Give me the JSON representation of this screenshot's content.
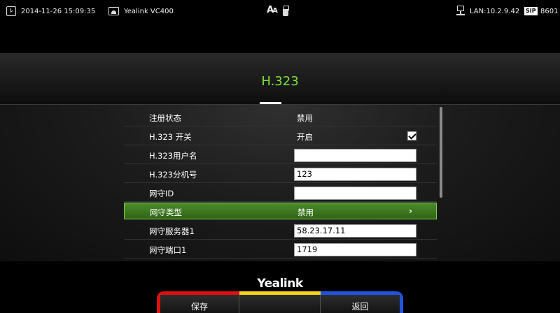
{
  "status_bar": {
    "datetime": "2014-11-26 15:09:35",
    "device": "Yealink VC400",
    "font_icon_text": "A",
    "font_icon_text_small": "A",
    "lan": "LAN:10.2.9.42",
    "sip_badge": "SIP",
    "extension": "8601"
  },
  "page": {
    "title": "H.323"
  },
  "settings": {
    "rows": [
      {
        "label": "注册状态",
        "value": "禁用"
      },
      {
        "label": "H.323 开关",
        "value": "开启",
        "checked": true
      },
      {
        "label": "H.323用户名",
        "input": ""
      },
      {
        "label": "H.323分机号",
        "input": "123"
      },
      {
        "label": "网守ID",
        "input": ""
      },
      {
        "label": "网守类型",
        "value": "禁用",
        "selected": true
      },
      {
        "label": "网守服务器1",
        "input": "58.23.17.11"
      },
      {
        "label": "网守端口1",
        "input": "1719"
      }
    ]
  },
  "footer": {
    "brand": "Yealink",
    "softkeys": {
      "save": "保存",
      "middle": "",
      "back": "返回"
    }
  },
  "colors": {
    "accent": "#7ee23b",
    "selected_row": "#3d7a1e",
    "red": "#e01010",
    "yellow": "#f2d21a",
    "blue": "#1f55e0"
  },
  "icons": {
    "clock": "clock-icon",
    "device": "video-device-icon",
    "usb": "usb-icon",
    "lan": "network-icon",
    "chevron": "chevron-right-icon"
  }
}
